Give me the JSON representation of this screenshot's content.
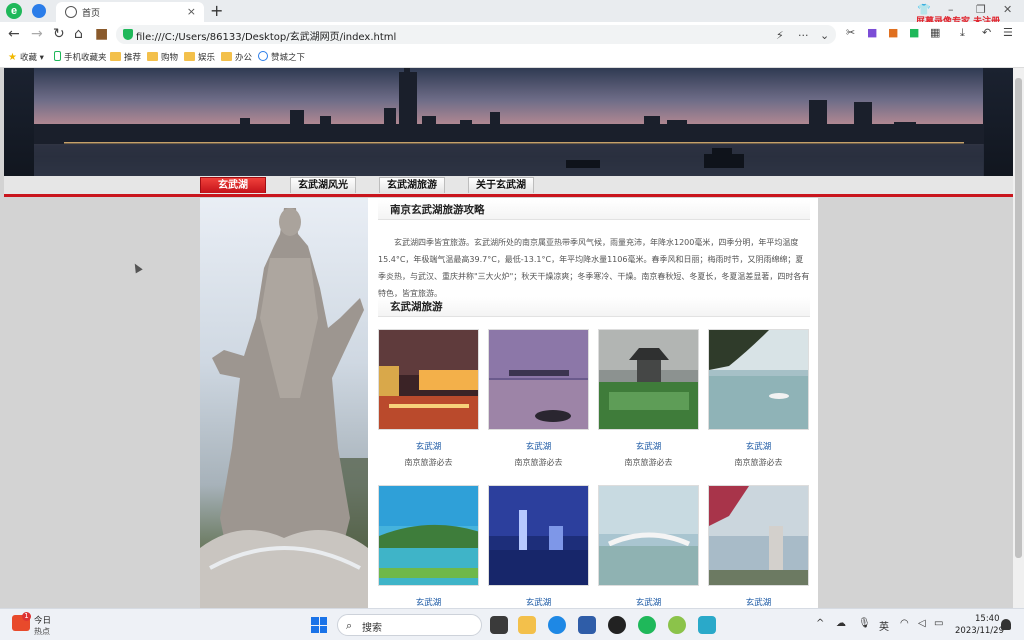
{
  "browser": {
    "tab_title": "首页",
    "tab_close": "×",
    "new_tab": "+",
    "url": "file:///C:/Users/86133/Desktop/玄武湖网页/index.html",
    "recorder_watermark": "屏幕录像专家 未注册",
    "bookmarks": [
      {
        "label": "收藏",
        "icon": "star-icon"
      },
      {
        "label": "手机收藏夹",
        "icon": "phone-icon"
      },
      {
        "label": "推荐",
        "icon": "folder-icon"
      },
      {
        "label": "购物",
        "icon": "folder-icon"
      },
      {
        "label": "娱乐",
        "icon": "folder-icon"
      },
      {
        "label": "办公",
        "icon": "folder-icon"
      },
      {
        "label": "赞城之下",
        "icon": "globe-icon"
      }
    ]
  },
  "site": {
    "nav": [
      {
        "label": "玄武湖",
        "active": true
      },
      {
        "label": "玄武湖风光",
        "active": false
      },
      {
        "label": "玄武湖旅游",
        "active": false
      },
      {
        "label": "关于玄武湖",
        "active": false
      }
    ],
    "section1_title": "南京玄武湖旅游攻略",
    "intro": "玄武湖四季皆宜旅游。玄武湖所处的南京属亚热带季风气候，雨量充沛，年降水1200毫米，四季分明，年平均温度15.4°C，年极端气温最高39.7°C，最低-13.1°C，年平均降水量1106毫米。春季风和日丽；梅雨时节，又阴雨绵绵；夏季炎热，与武汉、重庆并称\"三大火炉\"；秋天干燥凉爽；冬季寒冷、干燥。南京春秋短、冬夏长，冬夏温差显著，四时各有特色，皆宜旅游。",
    "section2_title": "玄武湖旅游",
    "cards": [
      {
        "title": "玄武湖",
        "subtitle": "南京旅游必去"
      },
      {
        "title": "玄武湖",
        "subtitle": "南京旅游必去"
      },
      {
        "title": "玄武湖",
        "subtitle": "南京旅游必去"
      },
      {
        "title": "玄武湖",
        "subtitle": "南京旅游必去"
      },
      {
        "title": "玄武湖",
        "subtitle": ""
      },
      {
        "title": "玄武湖",
        "subtitle": ""
      },
      {
        "title": "玄武湖",
        "subtitle": ""
      },
      {
        "title": "玄武湖",
        "subtitle": ""
      }
    ]
  },
  "taskbar": {
    "weather_line1": "今日",
    "weather_line2": "热点",
    "weather_badge": "1",
    "search_placeholder": "搜索",
    "ime": "英",
    "time": "15:40",
    "date": "2023/11/29"
  },
  "colors": {
    "accent_red": "#c9151d",
    "link_blue": "#1d5aa5",
    "browser_green": "#1fb85a"
  }
}
